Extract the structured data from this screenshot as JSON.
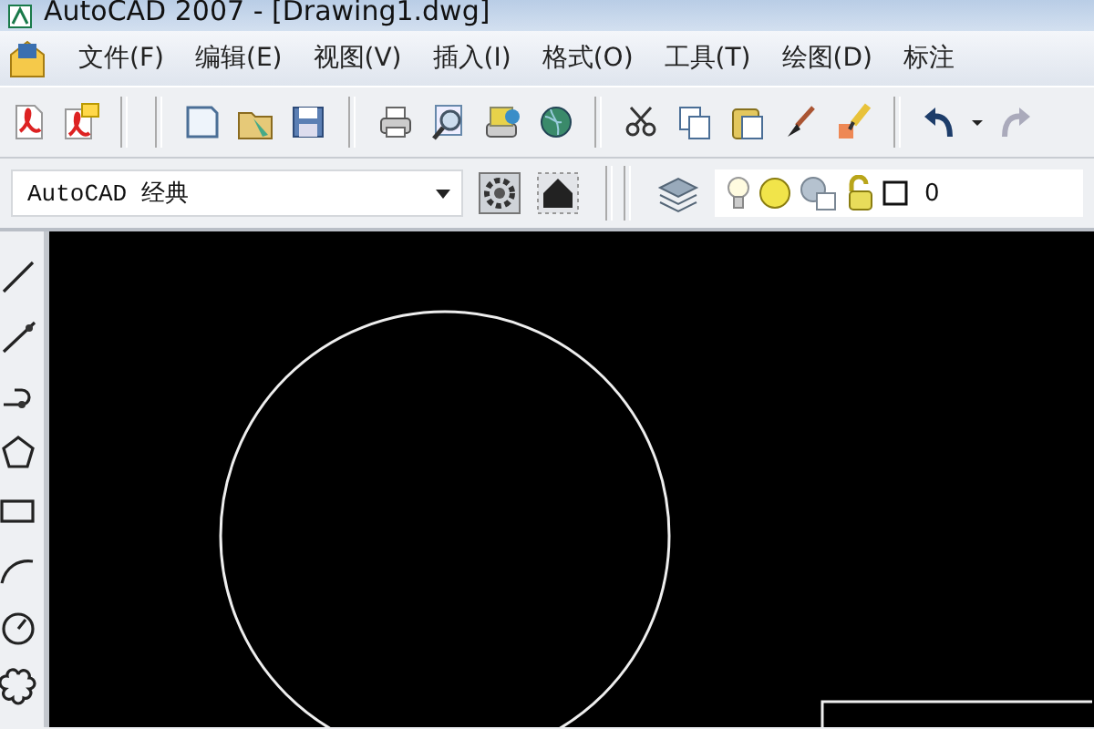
{
  "window": {
    "title": "AutoCAD 2007 - [Drawing1.dwg]"
  },
  "menu": [
    {
      "label": "文件(F)"
    },
    {
      "label": "编辑(E)"
    },
    {
      "label": "视图(V)"
    },
    {
      "label": "插入(I)"
    },
    {
      "label": "格式(O)"
    },
    {
      "label": "工具(T)"
    },
    {
      "label": "绘图(D)"
    },
    {
      "label": "标注"
    }
  ],
  "workspace": {
    "value": "AutoCAD 经典"
  },
  "layer": {
    "value": "0"
  }
}
